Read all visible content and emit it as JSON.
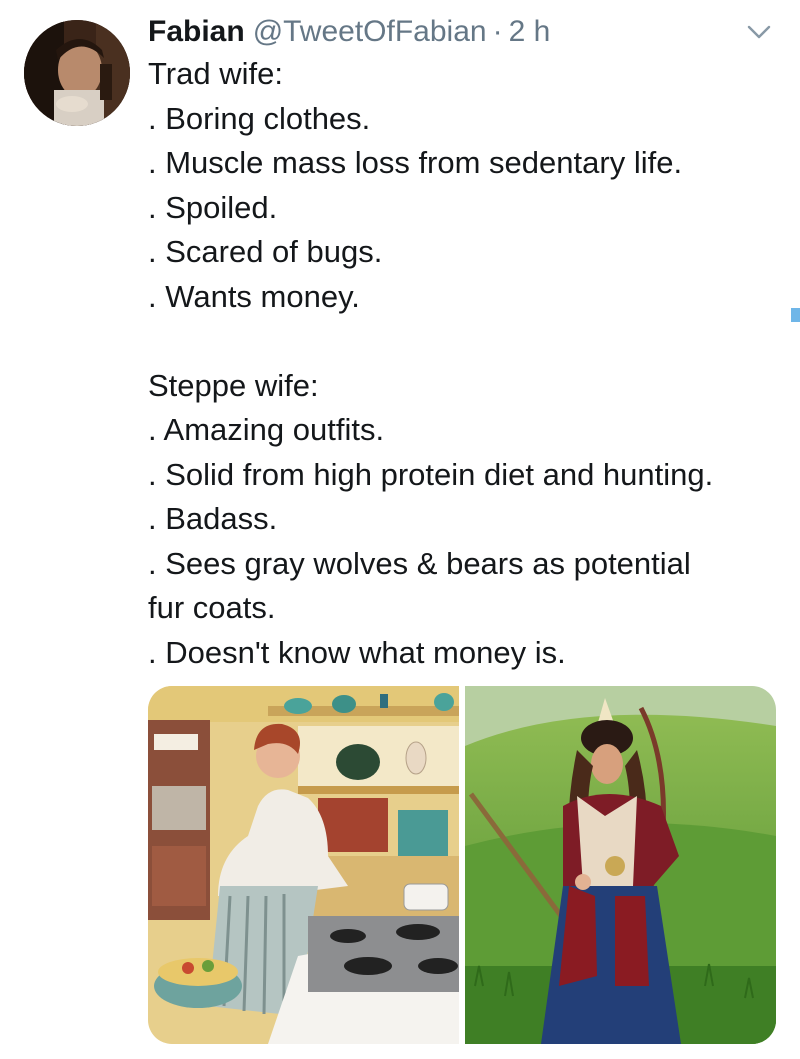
{
  "tweet": {
    "author_name": "Fabian",
    "author_handle": "@TweetOfFabian",
    "separator": "·",
    "timestamp": "2 h",
    "lines": [
      "Trad wife:",
      ". Boring clothes.",
      ". Muscle mass loss from sedentary life.",
      ". Spoiled.",
      ". Scared of bugs.",
      ". Wants money.",
      "",
      "Steppe wife:",
      ". Amazing outfits.",
      ". Solid from high protein diet and hunting.",
      ". Badass.",
      ". Sees gray wolves & bears as potential",
      "fur coats.",
      ". Doesn't know what money is."
    ]
  },
  "icons": {
    "avatar": "user-avatar",
    "menu": "chevron-down-icon"
  },
  "images": [
    {
      "name": "retro-kitchen-housewife-photo"
    },
    {
      "name": "steppe-warrior-woman-photo"
    }
  ],
  "colors": {
    "text": "#14171a",
    "secondary": "#657786",
    "accent": "#6fb6e8"
  }
}
